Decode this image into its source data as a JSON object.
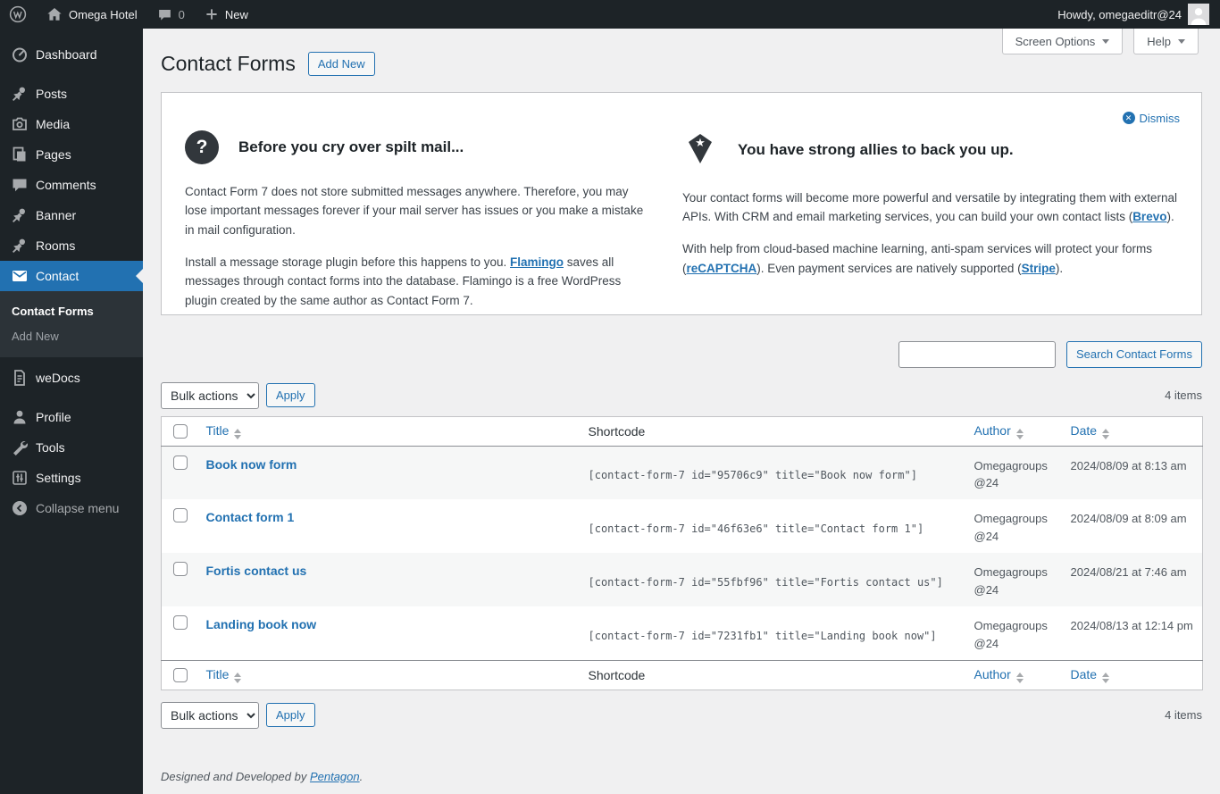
{
  "admin_bar": {
    "site_name": "Omega Hotel",
    "comments_count": "0",
    "new_label": "New",
    "howdy": "Howdy, omegaeditr@24"
  },
  "sidebar": {
    "items": [
      {
        "label": "Dashboard"
      },
      {
        "label": "Posts"
      },
      {
        "label": "Media"
      },
      {
        "label": "Pages"
      },
      {
        "label": "Comments"
      },
      {
        "label": "Banner"
      },
      {
        "label": "Rooms"
      },
      {
        "label": "Contact"
      },
      {
        "label": "weDocs"
      },
      {
        "label": "Profile"
      },
      {
        "label": "Tools"
      },
      {
        "label": "Settings"
      },
      {
        "label": "Collapse menu"
      }
    ],
    "submenu": {
      "items": [
        {
          "label": "Contact Forms"
        },
        {
          "label": "Add New"
        }
      ]
    }
  },
  "page": {
    "title": "Contact Forms",
    "add_new": "Add New",
    "screen_options": "Screen Options",
    "help": "Help"
  },
  "notice": {
    "dismiss": "Dismiss",
    "left": {
      "heading": "Before you cry over spilt mail...",
      "p1": "Contact Form 7 does not store submitted messages anywhere. Therefore, you may lose important messages forever if your mail server has issues or you make a mistake in mail configuration.",
      "p2_before": "Install a message storage plugin before this happens to you. ",
      "p2_link": "Flamingo",
      "p2_after": " saves all messages through contact forms into the database. Flamingo is a free WordPress plugin created by the same author as Contact Form 7."
    },
    "right": {
      "heading": "You have strong allies to back you up.",
      "p1_before": "Your contact forms will become more powerful and versatile by integrating them with external APIs. With CRM and email marketing services, you can build your own contact lists (",
      "p1_link": "Brevo",
      "p1_after": ").",
      "p2_before": "With help from cloud-based machine learning, anti-spam services will protect your forms (",
      "p2_link1": "reCAPTCHA",
      "p2_mid": "). Even payment services are natively supported (",
      "p2_link2": "Stripe",
      "p2_after": ")."
    }
  },
  "list": {
    "search_button": "Search Contact Forms",
    "bulk_actions_label": "Bulk actions",
    "apply_label": "Apply",
    "count": "4 items",
    "columns": {
      "title": "Title",
      "shortcode": "Shortcode",
      "author": "Author",
      "date": "Date"
    },
    "rows": [
      {
        "title": "Book now form",
        "shortcode": "[contact-form-7 id=\"95706c9\" title=\"Book now form\"]",
        "author": "Omegagroups@24",
        "date": "2024/08/09 at 8:13 am"
      },
      {
        "title": "Contact form 1",
        "shortcode": "[contact-form-7 id=\"46f63e6\" title=\"Contact form 1\"]",
        "author": "Omegagroups@24",
        "date": "2024/08/09 at 8:09 am"
      },
      {
        "title": "Fortis contact us",
        "shortcode": "[contact-form-7 id=\"55fbf96\" title=\"Fortis contact us\"]",
        "author": "Omegagroups@24",
        "date": "2024/08/21 at 7:46 am"
      },
      {
        "title": "Landing book now",
        "shortcode": "[contact-form-7 id=\"7231fb1\" title=\"Landing book now\"]",
        "author": "Omegagroups@24",
        "date": "2024/08/13 at 12:14 pm"
      }
    ]
  },
  "footer": {
    "text_before": "Designed and Developed by ",
    "link": "Pentagon",
    "text_after": "."
  },
  "icons": {
    "wordpress-logo-icon": "W in circle",
    "home-icon": "house",
    "comments-bubble-icon": "speech bubble",
    "plus-icon": "plus",
    "dashboard-icon": "gauge",
    "pin-icon": "pushpin",
    "media-icon": "camera",
    "pages-icon": "stacked pages",
    "envelope-icon": "envelope",
    "document-icon": "document",
    "profile-icon": "person",
    "tools-icon": "wrench",
    "settings-icon": "sliders",
    "collapse-icon": "circle left arrow",
    "question-icon": "question mark circle",
    "allies-icon": "diamond with star",
    "dismiss-icon": "circle x",
    "sort-icon": "up/down arrows"
  },
  "colors": {
    "accent": "#2271b1",
    "adminbar_bg": "#1d2327",
    "submenu_bg": "#2c3338",
    "content_bg": "#f0f0f1",
    "row_stripe": "#f6f7f7"
  }
}
